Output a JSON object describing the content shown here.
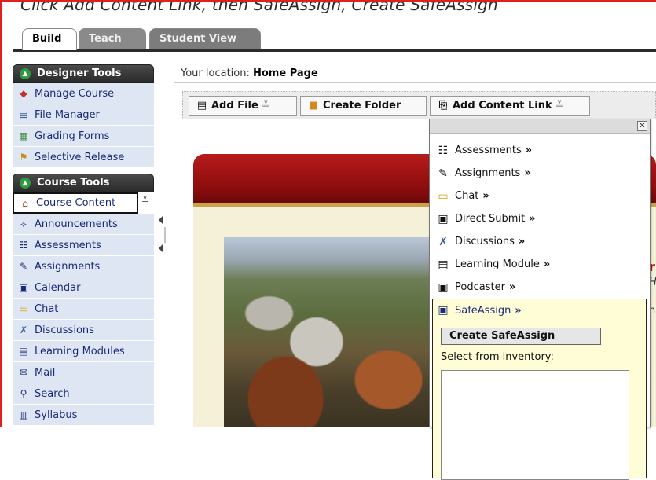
{
  "caption": "Click Add Content Link, then SafeAssign, Create SafeAssign",
  "tabs": [
    "Build",
    "Teach",
    "Student View"
  ],
  "sidebar": {
    "designer_tools": {
      "title": "Designer Tools",
      "items": [
        "Manage Course",
        "File Manager",
        "Grading Forms",
        "Selective Release"
      ]
    },
    "course_tools": {
      "title": "Course Tools",
      "items": [
        "Course Content",
        "Announcements",
        "Assessments",
        "Assignments",
        "Calendar",
        "Chat",
        "Discussions",
        "Learning Modules",
        "Mail",
        "Search",
        "Syllabus"
      ]
    }
  },
  "location": {
    "label": "Your location:",
    "value": "Home Page"
  },
  "toolbar": {
    "add_file": "Add File",
    "create_folder": "Create Folder",
    "add_content_link": "Add Content Link"
  },
  "menu": {
    "items": [
      "Assessments",
      "Assignments",
      "Chat",
      "Direct Submit",
      "Discussions",
      "Learning Module",
      "Podcaster"
    ],
    "arrow": "»",
    "open_item": "SafeAssign",
    "create_button": "Create SafeAssign",
    "select_label": "Select from inventory:"
  },
  "right_fragments": [
    "r",
    "H",
    "n"
  ],
  "colors": {
    "accent_red": "#e0201f",
    "sidebar_bg": "#dfe6f3",
    "menu_highlight": "#fffdd5"
  }
}
